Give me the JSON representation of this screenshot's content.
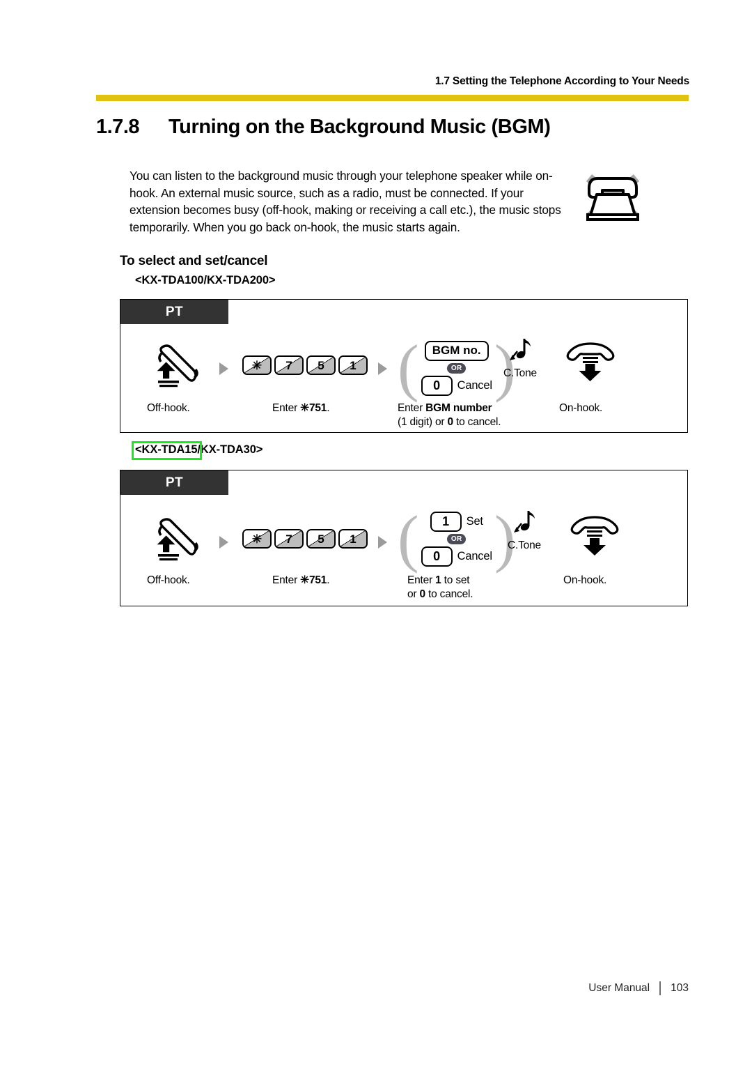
{
  "header": {
    "running_head": "1.7 Setting the Telephone According to Your Needs",
    "rule_color": "#e0c211"
  },
  "section": {
    "number": "1.7.8",
    "title": "Turning on the Background Music (BGM)"
  },
  "intro": {
    "paragraph": "You can listen to the background music through your telephone speaker while on-hook. An external music source, such as a radio, must be connected. If your extension becomes busy (off-hook, making or receiving a call etc.), the music stops temporarily. When you go back on-hook, the music starts again.",
    "icon": "telephone-not-available-icon"
  },
  "subheads": {
    "select_set_cancel": "To select and set/cancel"
  },
  "annotation": {
    "highlight_color": "#16ed16",
    "highlighted_text": "KX-TDA15"
  },
  "diagrams": [
    {
      "model_line": "<KX-TDA100/KX-TDA200>",
      "pt_tag": "PT",
      "steps": {
        "offhook_icon": "offhook-handset-icon",
        "keys": [
          "✳",
          "7",
          "5",
          "1"
        ],
        "choice": {
          "option_a_key": "BGM no.",
          "or": "OR",
          "option_b_key": "0",
          "option_b_label": "Cancel"
        },
        "ctone": "C.Tone",
        "onhook_icon": "onhook-handset-icon"
      },
      "captions": {
        "offhook": "Off-hook.",
        "enter_code_prefix": "Enter ",
        "enter_code_bold": "✳751",
        "enter_code_suffix": ".",
        "choice_line1_pre": "Enter ",
        "choice_line1_bold": "BGM number",
        "choice_line2_pre": "(1 digit) or ",
        "choice_line2_bold": "0",
        "choice_line2_post": " to cancel.",
        "onhook": "On-hook."
      }
    },
    {
      "model_line": "<KX-TDA15/KX-TDA30>",
      "pt_tag": "PT",
      "steps": {
        "offhook_icon": "offhook-handset-icon",
        "keys": [
          "✳",
          "7",
          "5",
          "1"
        ],
        "choice": {
          "option_a_key": "1",
          "option_a_label": "Set",
          "or": "OR",
          "option_b_key": "0",
          "option_b_label": "Cancel"
        },
        "ctone": "C.Tone",
        "onhook_icon": "onhook-handset-icon"
      },
      "captions": {
        "offhook": "Off-hook.",
        "enter_code_prefix": "Enter ",
        "enter_code_bold": "✳751",
        "enter_code_suffix": ".",
        "choice_line1_pre": "Enter ",
        "choice_line1_bold": "1",
        "choice_line1_post": " to set",
        "choice_line2_pre": "or ",
        "choice_line2_bold": "0",
        "choice_line2_post": " to cancel.",
        "onhook": "On-hook."
      }
    }
  ],
  "footer": {
    "manual_label": "User Manual",
    "page_number": "103"
  }
}
